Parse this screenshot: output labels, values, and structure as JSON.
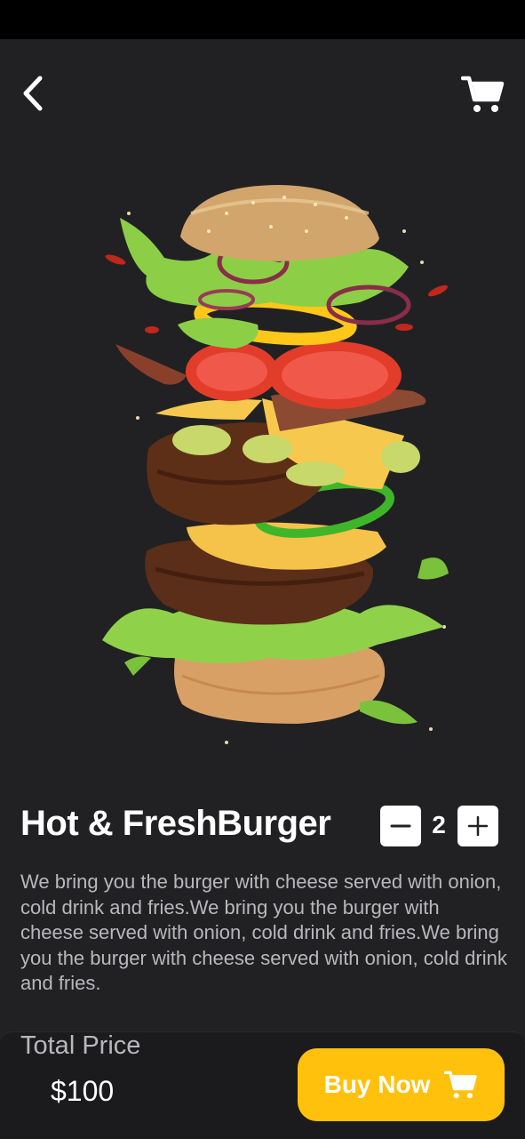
{
  "header": {
    "back_icon": "chevron-left-icon",
    "cart_icon": "cart-icon"
  },
  "product": {
    "image": "burger-illustration",
    "title": "Hot & FreshBurger",
    "quantity": "2",
    "description": "We bring you the burger with cheese served with onion, cold drink and fries.We bring you the burger with cheese served with onion, cold drink and fries.We bring you the burger with cheese served with onion, cold drink and fries."
  },
  "footer": {
    "total_label": "Total Price",
    "total_value": "$100",
    "buy_label": "Buy Now",
    "buy_icon": "cart-icon"
  },
  "colors": {
    "background": "#212124",
    "accent": "#ffc10b",
    "muted_text": "#b8b8bc"
  }
}
